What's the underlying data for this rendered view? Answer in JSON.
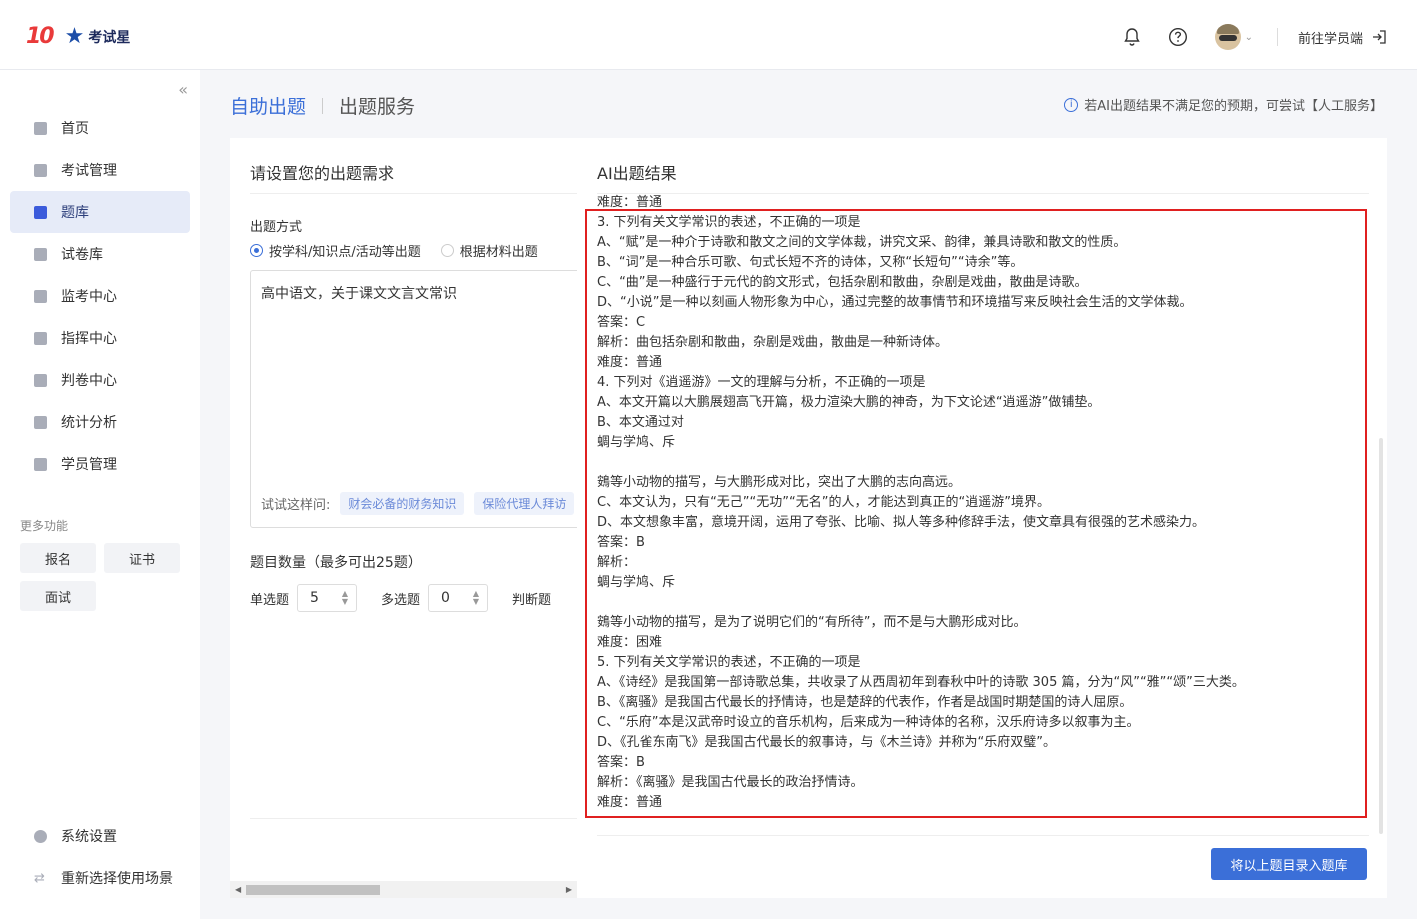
{
  "brand": {
    "logo_mark": "10",
    "name": "考试星"
  },
  "header": {
    "goto_label": "前往学员端"
  },
  "sidebar": {
    "collapse_glyph": "«",
    "items": [
      {
        "label": "首页"
      },
      {
        "label": "考试管理"
      },
      {
        "label": "题库"
      },
      {
        "label": "试卷库"
      },
      {
        "label": "监考中心"
      },
      {
        "label": "指挥中心"
      },
      {
        "label": "判卷中心"
      },
      {
        "label": "统计分析"
      },
      {
        "label": "学员管理"
      }
    ],
    "active_index": 2,
    "more_title": "更多功能",
    "more_items": [
      {
        "label": "报名"
      },
      {
        "label": "证书"
      },
      {
        "label": "面试"
      }
    ],
    "bottom_items": [
      {
        "label": "系统设置"
      },
      {
        "label": "重新选择使用场景"
      }
    ]
  },
  "breadcrumb": {
    "active": "自助出题",
    "other": "出题服务"
  },
  "notice": {
    "text": "若AI出题结果不满足您的预期，可尝试【人工服务】"
  },
  "left_panel": {
    "title": "请设置您的出题需求",
    "method_label": "出题方式",
    "option_1": "按学科/知识点/活动等出题",
    "option_2": "根据材料出题",
    "input_value": "高中语文，关于课文文言文常识",
    "try_label": "试试这样问:",
    "suggestions": [
      "财会必备的财务知识",
      "保险代理人拜访"
    ],
    "count_label": "题目数量（最多可出25题）",
    "single_label": "单选题",
    "single_value": "5",
    "multi_label": "多选题",
    "multi_value": "0",
    "judge_label": "判断题"
  },
  "right_panel": {
    "title": "AI出题结果",
    "lines": [
      "难度：普通",
      "3. 下列有关文学常识的表述，不正确的一项是",
      "A、“赋”是一种介于诗歌和散文之间的文学体裁，讲究文采、韵律，兼具诗歌和散文的性质。",
      "B、“词”是一种合乐可歌、句式长短不齐的诗体，又称“长短句”“诗余”等。",
      "C、“曲”是一种盛行于元代的韵文形式，包括杂剧和散曲，杂剧是戏曲，散曲是诗歌。",
      "D、“小说”是一种以刻画人物形象为中心，通过完整的故事情节和环境描写来反映社会生活的文学体裁。",
      "答案：C",
      "解析：曲包括杂剧和散曲，杂剧是戏曲，散曲是一种新诗体。",
      "难度：普通",
      "4. 下列对《逍遥游》一文的理解与分析，不正确的一项是",
      "A、本文开篇以大鹏展翅高飞开篇，极力渲染大鹏的神奇，为下文论述“逍遥游”做铺垫。",
      "B、本文通过对",
      "蜩与学鸠、斥",
      "",
      "鴳等小动物的描写，与大鹏形成对比，突出了大鹏的志向高远。",
      "C、本文认为，只有“无己”“无功”“无名”的人，才能达到真正的“逍遥游”境界。",
      "D、本文想象丰富，意境开阔，运用了夸张、比喻、拟人等多种修辞手法，使文章具有很强的艺术感染力。",
      "答案：B",
      "解析：",
      "蜩与学鸠、斥",
      "",
      "鴳等小动物的描写，是为了说明它们的“有所待”，而不是与大鹏形成对比。",
      "难度：困难",
      "5. 下列有关文学常识的表述，不正确的一项是",
      "A、《诗经》是我国第一部诗歌总集，共收录了从西周初年到春秋中叶的诗歌 305 篇，分为“风”“雅”“颂”三大类。",
      "B、《离骚》是我国古代最长的抒情诗，也是楚辞的代表作，作者是战国时期楚国的诗人屈原。",
      "C、“乐府”本是汉武帝时设立的音乐机构，后来成为一种诗体的名称，汉乐府诗多以叙事为主。",
      "D、《孔雀东南飞》是我国古代最长的叙事诗，与《木兰诗》并称为“乐府双璧”。",
      "答案：B",
      "解析：《离骚》是我国古代最长的政治抒情诗。",
      "难度：普通"
    ],
    "submit_label": "将以上题目录入题库"
  }
}
